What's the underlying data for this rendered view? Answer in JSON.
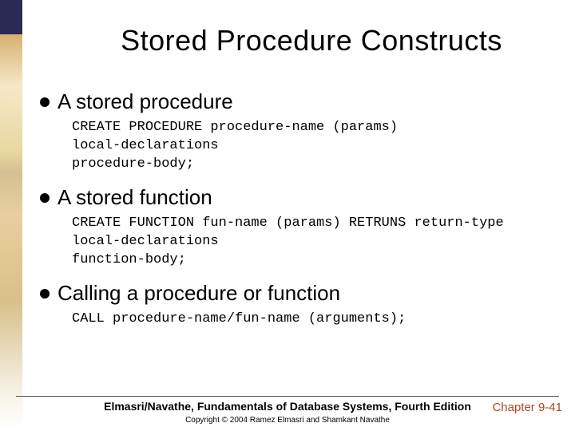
{
  "title": "Stored Procedure Constructs",
  "bullets": [
    {
      "heading": "A stored procedure",
      "code": "CREATE PROCEDURE procedure-name (params)\nlocal-declarations\nprocedure-body;"
    },
    {
      "heading": "A stored function",
      "code": "CREATE FUNCTION fun-name (params) RETRUNS return-type\nlocal-declarations\nfunction-body;"
    },
    {
      "heading": "Calling a procedure or function",
      "code": "CALL procedure-name/fun-name (arguments);"
    }
  ],
  "footer": {
    "main": "Elmasri/Navathe, Fundamentals of Database Systems, Fourth Edition",
    "chapter": "Chapter 9-41",
    "copyright": "Copyright © 2004 Ramez Elmasri and Shamkant Navathe"
  }
}
